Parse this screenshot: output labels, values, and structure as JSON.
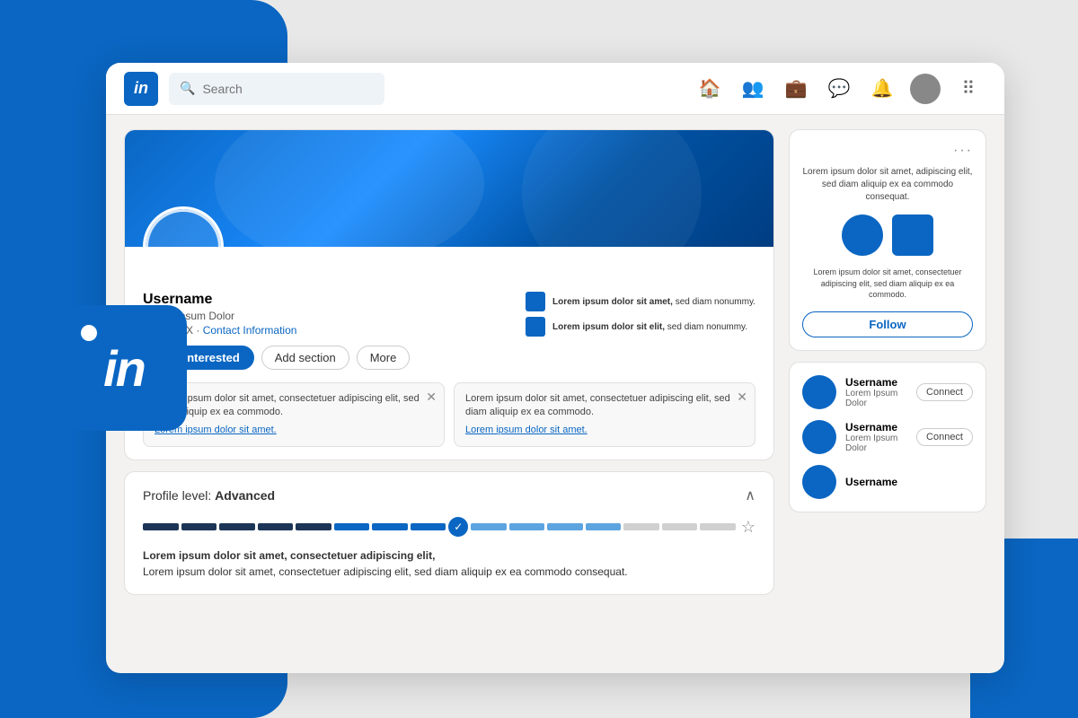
{
  "background": {
    "leftColor": "#0a66c2",
    "rightColor": "#0a66c2"
  },
  "badge": {
    "text": "in"
  },
  "navbar": {
    "logoText": "in",
    "searchPlaceholder": "Search",
    "icons": [
      "home",
      "people",
      "briefcase",
      "chat",
      "bell",
      "avatar",
      "grid"
    ]
  },
  "profile": {
    "username": "Username",
    "subtitle": "Lorem Ipsum Dolor",
    "location": "Cdmx. MX",
    "contactLink": "Contact Information",
    "sideItem1": {
      "label": "Lorem ipsum dolor sit amet,",
      "sub": "sed diam nonummy."
    },
    "sideItem2": {
      "label": "Lorem ipsum dolor sit elit,",
      "sub": "sed diam nonummy."
    },
    "actions": {
      "interested": "I am interested",
      "addSection": "Add section",
      "more": "More"
    },
    "alerts": [
      {
        "text": "Lorem ipsum dolor sit amet, consectetuer adipiscing elit, sed diam aliquip ex ea commodo.",
        "link": "Lorem ipsum dolor sit amet."
      },
      {
        "text": "Lorem ipsum dolor sit amet, consectetuer adipiscing elit, sed diam aliquip ex ea commodo.",
        "link": "Lorem ipsum dolor sit amet."
      }
    ]
  },
  "profileLevel": {
    "title": "Profile level:",
    "level": "Advanced",
    "description": "Lorem ipsum dolor sit amet, consectetuer adipiscing elit,\nsed diam aliquip ex ea commodo consequat.",
    "progressSegments": [
      "dark",
      "dark",
      "dark",
      "dark",
      "dark",
      "blue",
      "blue",
      "blue",
      "check",
      "light",
      "light",
      "light",
      "light",
      "empty",
      "empty",
      "empty",
      "empty",
      "empty"
    ]
  },
  "adCard": {
    "descTop": "Lorem ipsum dolor sit amet, adipiscing elit, sed diam aliquip ex ea commodo consequat.",
    "descBottom": "Lorem ipsum dolor sit amet, consectetuer adipiscing elit, sed diam aliquip ex ea commodo.",
    "followLabel": "Follow"
  },
  "connections": [
    {
      "name": "Username",
      "sub": "Lorem Ipsum Dolor",
      "action": "Connect"
    },
    {
      "name": "Username",
      "sub": "Lorem Ipsum Dolor",
      "action": "Connect"
    },
    {
      "name": "Username",
      "sub": "Lorem Ipsum Dolor"
    }
  ]
}
